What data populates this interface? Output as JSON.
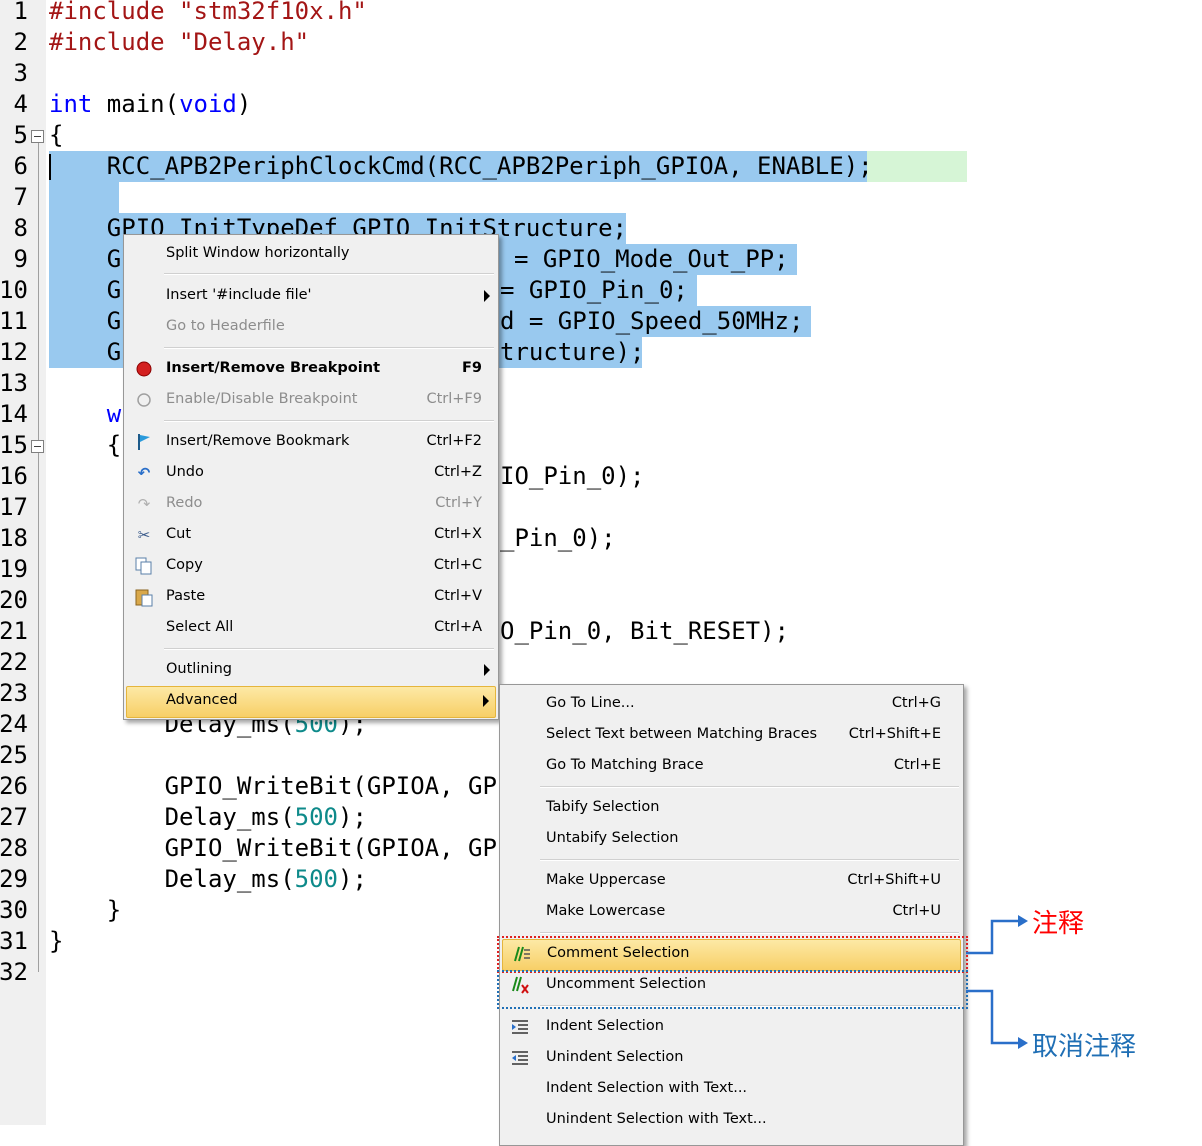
{
  "editor": {
    "lines": [
      {
        "n": "1",
        "code": "#include \"stm32f10x.h\""
      },
      {
        "n": "2",
        "code": "#include \"Delay.h\""
      },
      {
        "n": "3",
        "code": ""
      },
      {
        "n": "4",
        "code": "int main(void)"
      },
      {
        "n": "5",
        "code": "{"
      },
      {
        "n": "6",
        "code": "    RCC_APB2PeriphClockCmd(RCC_APB2Periph_GPIOA, ENABLE);"
      },
      {
        "n": "7",
        "code": ""
      },
      {
        "n": "8",
        "code": "    GPIO_InitTypeDef GPIO_InitStructure;"
      },
      {
        "n": "9",
        "code": "    GP",
        "tail": "= GPIO_Mode_Out_PP;"
      },
      {
        "n": "10",
        "code": "    GP",
        "tail": "= GPIO_Pin_0;"
      },
      {
        "n": "11",
        "code": "    GP",
        "tail": "d = GPIO_Speed_50MHz;"
      },
      {
        "n": "12",
        "code": "    GP",
        "tail": "tructure);"
      },
      {
        "n": "13",
        "code": ""
      },
      {
        "n": "14",
        "code": "    wh"
      },
      {
        "n": "15",
        "code": "    {"
      },
      {
        "n": "16",
        "code": "",
        "tail": "IO_Pin_0);"
      },
      {
        "n": "17",
        "code": ""
      },
      {
        "n": "18",
        "code": "",
        "tail": "_Pin_0);"
      },
      {
        "n": "19",
        "code": ""
      },
      {
        "n": "20",
        "code": ""
      },
      {
        "n": "21",
        "code": "",
        "tail": "O_Pin_0, Bit_RESET);"
      },
      {
        "n": "22",
        "code": ""
      },
      {
        "n": "23",
        "code": ""
      },
      {
        "n": "24",
        "code": "        Delay_ms(500);"
      },
      {
        "n": "25",
        "code": ""
      },
      {
        "n": "26",
        "code": "        GPIO_WriteBit(GPIOA, GPI"
      },
      {
        "n": "27",
        "code": "        Delay_ms(500);"
      },
      {
        "n": "28",
        "code": "        GPIO_WriteBit(GPIOA, GPI"
      },
      {
        "n": "29",
        "code": "        Delay_ms(500);"
      },
      {
        "n": "30",
        "code": "    }"
      },
      {
        "n": "31",
        "code": "}"
      },
      {
        "n": "32",
        "code": ""
      }
    ]
  },
  "context_menu": {
    "split_window": "Split Window horizontally",
    "insert_include": "Insert '#include file'",
    "go_to_headerfile": "Go to Headerfile",
    "insert_remove_breakpoint": "Insert/Remove Breakpoint",
    "insert_remove_breakpoint_sc": "F9",
    "enable_disable_breakpoint": "Enable/Disable Breakpoint",
    "enable_disable_breakpoint_sc": "Ctrl+F9",
    "insert_remove_bookmark": "Insert/Remove Bookmark",
    "insert_remove_bookmark_sc": "Ctrl+F2",
    "undo": "Undo",
    "undo_sc": "Ctrl+Z",
    "redo": "Redo",
    "redo_sc": "Ctrl+Y",
    "cut": "Cut",
    "cut_sc": "Ctrl+X",
    "copy": "Copy",
    "copy_sc": "Ctrl+C",
    "paste": "Paste",
    "paste_sc": "Ctrl+V",
    "select_all": "Select All",
    "select_all_sc": "Ctrl+A",
    "outlining": "Outlining",
    "advanced": "Advanced"
  },
  "advanced_menu": {
    "go_to_line": "Go To Line...",
    "go_to_line_sc": "Ctrl+G",
    "select_text_braces": "Select Text between Matching Braces",
    "select_text_braces_sc": "Ctrl+Shift+E",
    "go_to_matching_brace": "Go To Matching Brace",
    "go_to_matching_brace_sc": "Ctrl+E",
    "tabify": "Tabify Selection",
    "untabify": "Untabify Selection",
    "make_uppercase": "Make Uppercase",
    "make_uppercase_sc": "Ctrl+Shift+U",
    "make_lowercase": "Make Lowercase",
    "make_lowercase_sc": "Ctrl+U",
    "comment_selection": "Comment Selection",
    "uncomment_selection": "Uncomment Selection",
    "indent_selection": "Indent Selection",
    "unindent_selection": "Unindent Selection",
    "indent_with_text": "Indent Selection with Text...",
    "unindent_with_text": "Unindent Selection with Text..."
  },
  "annotations": {
    "comment": "注释",
    "uncomment": "取消注释",
    "comment_color": "#ff0000",
    "uncomment_color": "#1f6fb5"
  }
}
